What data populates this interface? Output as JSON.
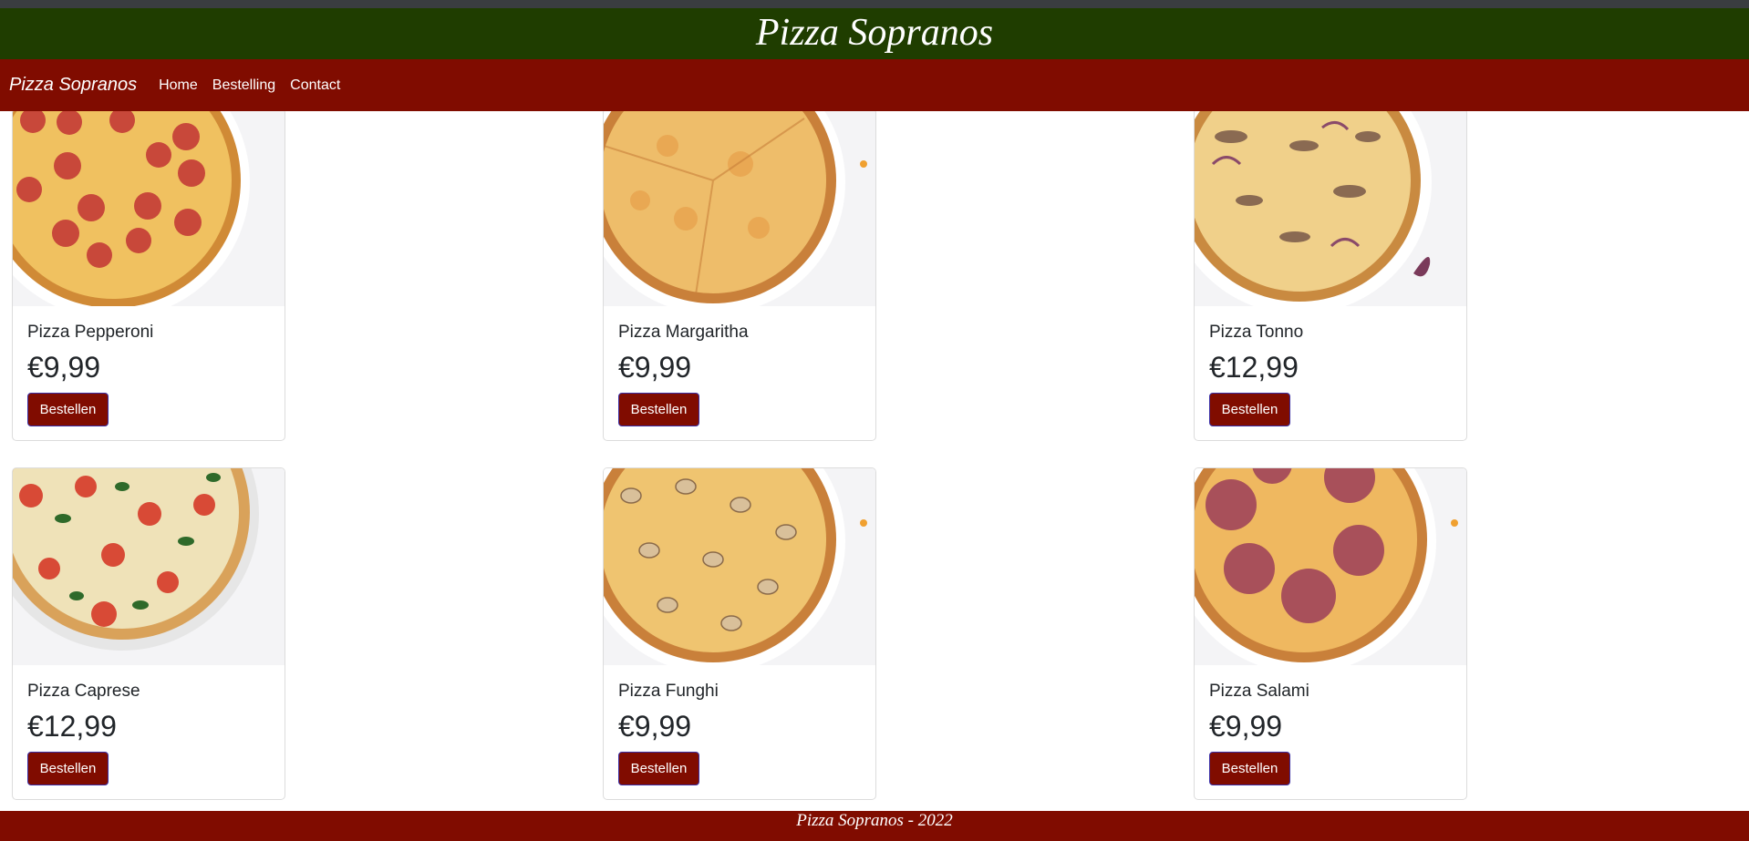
{
  "site": {
    "banner_title": "Pizza Sopranos"
  },
  "navbar": {
    "brand": "Pizza Sopranos",
    "links": [
      "Home",
      "Bestelling",
      "Contact"
    ]
  },
  "products": [
    {
      "name": "Pizza Pepperoni",
      "price": "€9,99",
      "button": "Bestellen",
      "image": "pizza-pepperoni-image"
    },
    {
      "name": "Pizza Margaritha",
      "price": "€9,99",
      "button": "Bestellen",
      "image": "pizza-margaritha-image"
    },
    {
      "name": "Pizza Tonno",
      "price": "€12,99",
      "button": "Bestellen",
      "image": "pizza-tonno-image"
    },
    {
      "name": "Pizza Caprese",
      "price": "€12,99",
      "button": "Bestellen",
      "image": "pizza-caprese-image"
    },
    {
      "name": "Pizza Funghi",
      "price": "€9,99",
      "button": "Bestellen",
      "image": "pizza-funghi-image"
    },
    {
      "name": "Pizza Salami",
      "price": "€9,99",
      "button": "Bestellen",
      "image": "pizza-salami-image"
    }
  ],
  "footer": {
    "text": "Pizza Sopranos - 2022"
  },
  "colors": {
    "banner": "#1f3d00",
    "navbar": "#800c00",
    "button": "#800c00",
    "footer": "#800c00"
  }
}
